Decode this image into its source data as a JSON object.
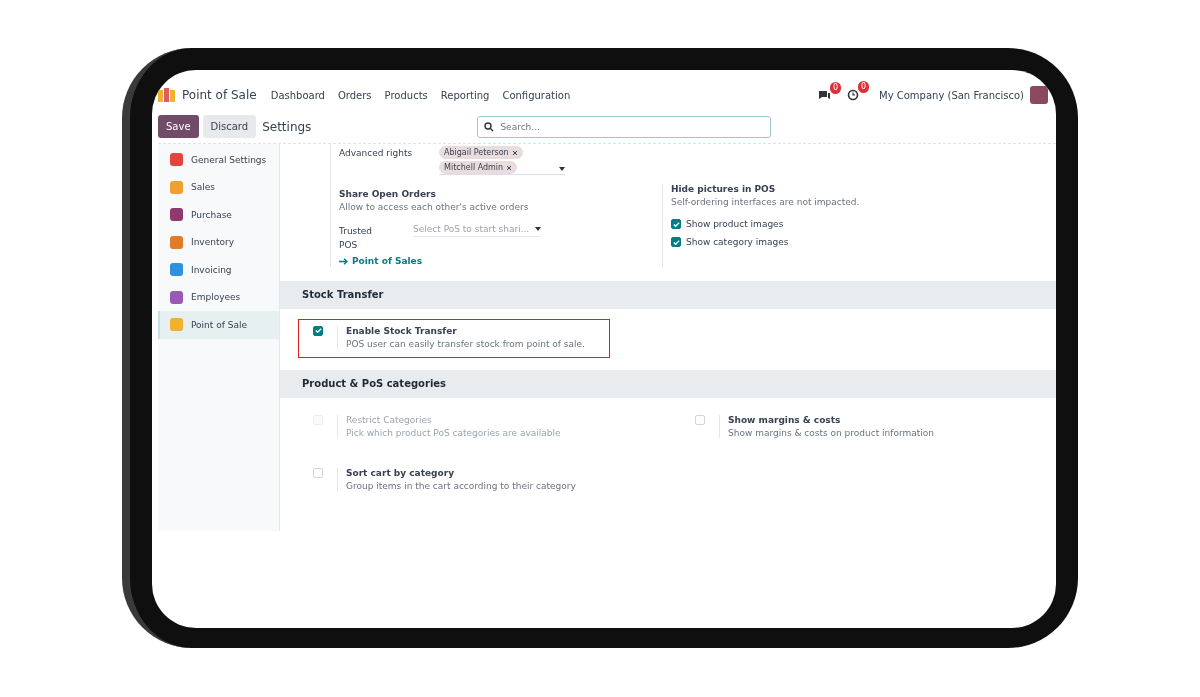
{
  "app": {
    "name": "Point of Sale"
  },
  "menu": [
    "Dashboard",
    "Orders",
    "Products",
    "Reporting",
    "Configuration"
  ],
  "systray": {
    "messages_count": "0",
    "activities_count": "0",
    "company": "My Company (San Francisco)"
  },
  "control_panel": {
    "save": "Save",
    "discard": "Discard",
    "title": "Settings",
    "search": {
      "placeholder": "Search..."
    }
  },
  "sidebar": {
    "items": [
      {
        "label": "General Settings",
        "selected": false,
        "color": "#e0473a"
      },
      {
        "label": "Sales",
        "selected": false,
        "color": "#f0a030"
      },
      {
        "label": "Purchase",
        "selected": false,
        "color": "#8e3a6e"
      },
      {
        "label": "Inventory",
        "selected": false,
        "color": "#e07b2a"
      },
      {
        "label": "Invoicing",
        "selected": false,
        "color": "#2f8fe0"
      },
      {
        "label": "Employees",
        "selected": false,
        "color": "#9b59b6"
      },
      {
        "label": "Point of Sale",
        "selected": true,
        "color": "#f0b030"
      }
    ]
  },
  "advanced_rights": {
    "label": "Advanced rights",
    "tags": [
      "Abigail Peterson",
      "Mitchell Admin"
    ]
  },
  "share_open_orders": {
    "title": "Share Open Orders",
    "description": "Allow to access each other's active orders",
    "trusted_label": "Trusted POS",
    "trusted_placeholder": "Select PoS to start shari...",
    "link": "Point of Sales"
  },
  "hide_pictures": {
    "title": "Hide pictures in POS",
    "description": "Self-ordering interfaces are not impacted.",
    "options": [
      {
        "label": "Show product images",
        "checked": true
      },
      {
        "label": "Show category images",
        "checked": true
      }
    ]
  },
  "sections": [
    {
      "title": "Stock Transfer",
      "settings": [
        {
          "title": "Enable Stock Transfer",
          "description": "POS user can easily transfer stock from point of sale.",
          "checked": true,
          "disabled": false,
          "highlighted": true
        }
      ]
    },
    {
      "title": "Product & PoS categories",
      "settings": [
        {
          "title": "Restrict Categories",
          "description": "Pick which product PoS categories are available",
          "checked": false,
          "disabled": true,
          "highlighted": false
        },
        {
          "title": "Show margins & costs",
          "description": "Show margins & costs on product information",
          "checked": false,
          "disabled": false,
          "highlighted": false
        },
        {
          "title": "Sort cart by category",
          "description": "Group items in the cart according to their category",
          "checked": false,
          "disabled": false,
          "highlighted": false
        }
      ]
    }
  ]
}
